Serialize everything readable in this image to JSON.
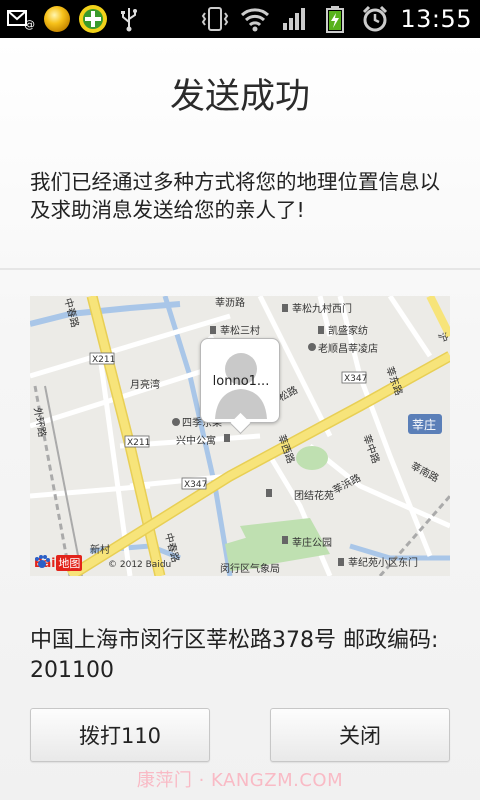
{
  "status_bar": {
    "time": "13:55",
    "left_icons": [
      "email-icon",
      "notification-dot-icon",
      "plus-app-icon",
      "usb-icon"
    ],
    "right_icons": [
      "vibrate-icon",
      "wifi-icon",
      "signal-icon",
      "battery-icon",
      "alarm-icon"
    ]
  },
  "title": "发送成功",
  "message": "我们已经通过多种方式将您的地理位置信息以及求助消息发送给您的亲人了!",
  "map": {
    "bubble_name": "lonno1...",
    "logo_text": "Bai",
    "logo_suffix": "地图",
    "copyright": "© 2012 Baidu",
    "labels": {
      "zhongchun_top": "中春路",
      "huashaan": "莘沥路",
      "huasong9": "莘松九村西门",
      "huasong3": "莘松三村",
      "kaisheng": "凯盛家纺",
      "laoshunchang": "老顺昌莘凌店",
      "road_x211_top": "X211",
      "yueliangwan": "月亮湾",
      "waihuan": "外环路",
      "x347_right": "X347",
      "huadong": "莘东路",
      "sixue": "四季东果",
      "xingzhong": "兴中公寓",
      "x211_mid": "X211",
      "huasong_road": "莘松路",
      "huaxi": "莘西路",
      "huazhong": "莘中路",
      "huazhuang": "莘庄",
      "huanan": "莘南路",
      "x347_mid": "X347",
      "tuanjie": "团结花苑",
      "huabin": "莘浜路",
      "zhongchun_bottom": "中春路",
      "huazhuang_park": "莘庄公园",
      "xincun": "新村",
      "minhang_office": "闵行区气象局",
      "huaji": "莘纪苑小区东门",
      "tiqiao": "沪"
    }
  },
  "address": "中国上海市闵行区莘松路378号 邮政编码: 201100",
  "buttons": {
    "call": "拨打110",
    "close": "关闭"
  },
  "watermark": "康萍门 · KANGZM.COM",
  "colors": {
    "status_bar": "#000000",
    "map_background": "#ecebe7",
    "main_road": "#f7e47a",
    "water": "#a9c6e8",
    "park": "#bfe0b1",
    "highway_sign": "#5b7fb8"
  }
}
